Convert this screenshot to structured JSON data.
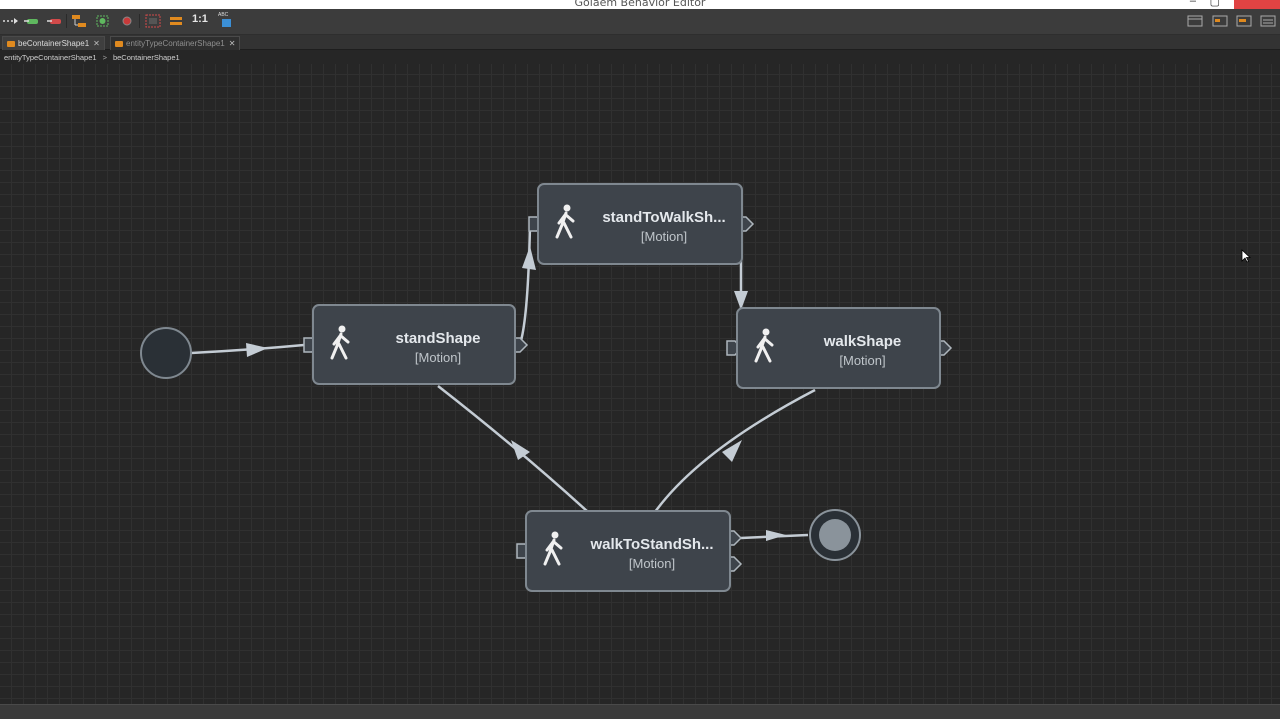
{
  "window": {
    "title": "Golaem Behavior Editor"
  },
  "toolbar": {
    "zoom_label": "1:1",
    "abc_label": "ABC"
  },
  "tabs": [
    {
      "label": "beContainerShape1",
      "close": "✕"
    },
    {
      "label": "entityTypeContainerShape1",
      "close": "✕"
    }
  ],
  "breadcrumb": {
    "items": [
      "entityTypeContainerShape1",
      "beContainerShape1"
    ],
    "separator": ">"
  },
  "nodes": {
    "stand": {
      "label": "standShape",
      "type": "[Motion]"
    },
    "standToWalk": {
      "label": "standToWalkSh...",
      "type": "[Motion]"
    },
    "walk": {
      "label": "walkShape",
      "type": "[Motion]"
    },
    "walkToStand": {
      "label": "walkToStandSh...",
      "type": "[Motion]"
    }
  },
  "colors": {
    "canvas": "#262626",
    "grid": "#303030",
    "node_fill": "#3e444b",
    "node_border": "#7f8890",
    "edge": "#c4ccd4",
    "title_bar": "#ffffff",
    "close_button": "#e04343"
  }
}
